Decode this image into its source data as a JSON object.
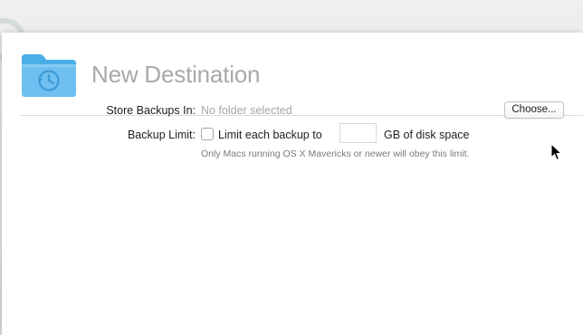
{
  "dialog": {
    "title": "New Destination"
  },
  "store_backups": {
    "label": "Store Backups In:",
    "value": "No folder selected",
    "choose_button": "Choose..."
  },
  "backup_limit": {
    "label": "Backup Limit:",
    "checkbox_label": "Limit each backup to",
    "checked": false,
    "gb_value": "",
    "unit_text": "GB of disk space",
    "help_text": "Only Macs running OS X Mavericks or newer will obey this limit."
  },
  "icons": {
    "header": "time-machine-folder-icon",
    "pointer": "mouse-pointer-icon"
  },
  "colors": {
    "folder_blue": "#6fc0f0",
    "title_gray": "#a9a9a9",
    "placeholder_gray": "#a6a6a6"
  }
}
